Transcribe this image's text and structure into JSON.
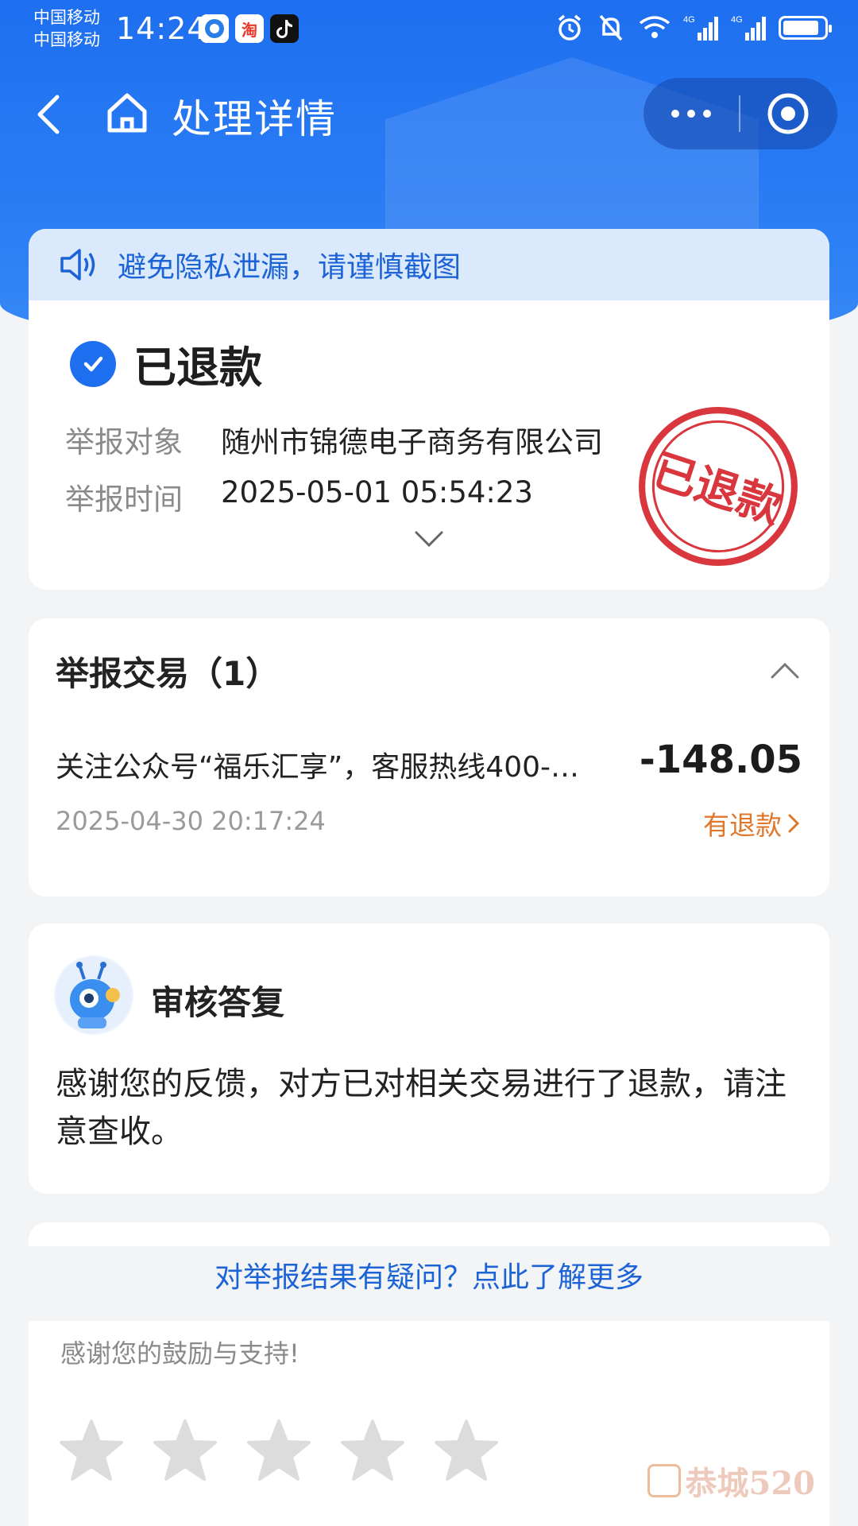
{
  "status_bar": {
    "carrier_1": "中国移动",
    "carrier_2": "中国移动",
    "time": "14:24",
    "app_taobao": "淘"
  },
  "nav": {
    "title": "处理详情"
  },
  "notice": {
    "text": "避免隐私泄漏，请谨慎截图"
  },
  "status": {
    "text": "已退款",
    "stamp_text": "已退款"
  },
  "report": {
    "target_label": "举报对象",
    "target_value": "随州市锦德电子商务有限公司",
    "time_label": "举报时间",
    "time_value": "2025-05-01 05:54:23"
  },
  "transactions": {
    "title": "举报交易（1）",
    "items": [
      {
        "name": "关注公众号“福乐汇享”，客服热线400-…",
        "amount": "-148.05",
        "time": "2025-04-30 20:17:24",
        "refund_label": "有退款"
      }
    ]
  },
  "reply": {
    "title": "审核答复",
    "body": "感谢您的反馈，对方已对相关交易进行了退款，请注意查收。"
  },
  "question_link": "对举报结果有疑问？点此了解更多",
  "feedback": {
    "text": "感谢您的鼓励与支持!",
    "rating": 0,
    "max_rating": 5
  },
  "watermark": {
    "text": "恭城520"
  },
  "colors": {
    "primary": "#1e6ff0",
    "notice_bg": "#dbe9fd",
    "link": "#1c63d6",
    "refund": "#e0782c",
    "stamp": "#d9363e"
  }
}
